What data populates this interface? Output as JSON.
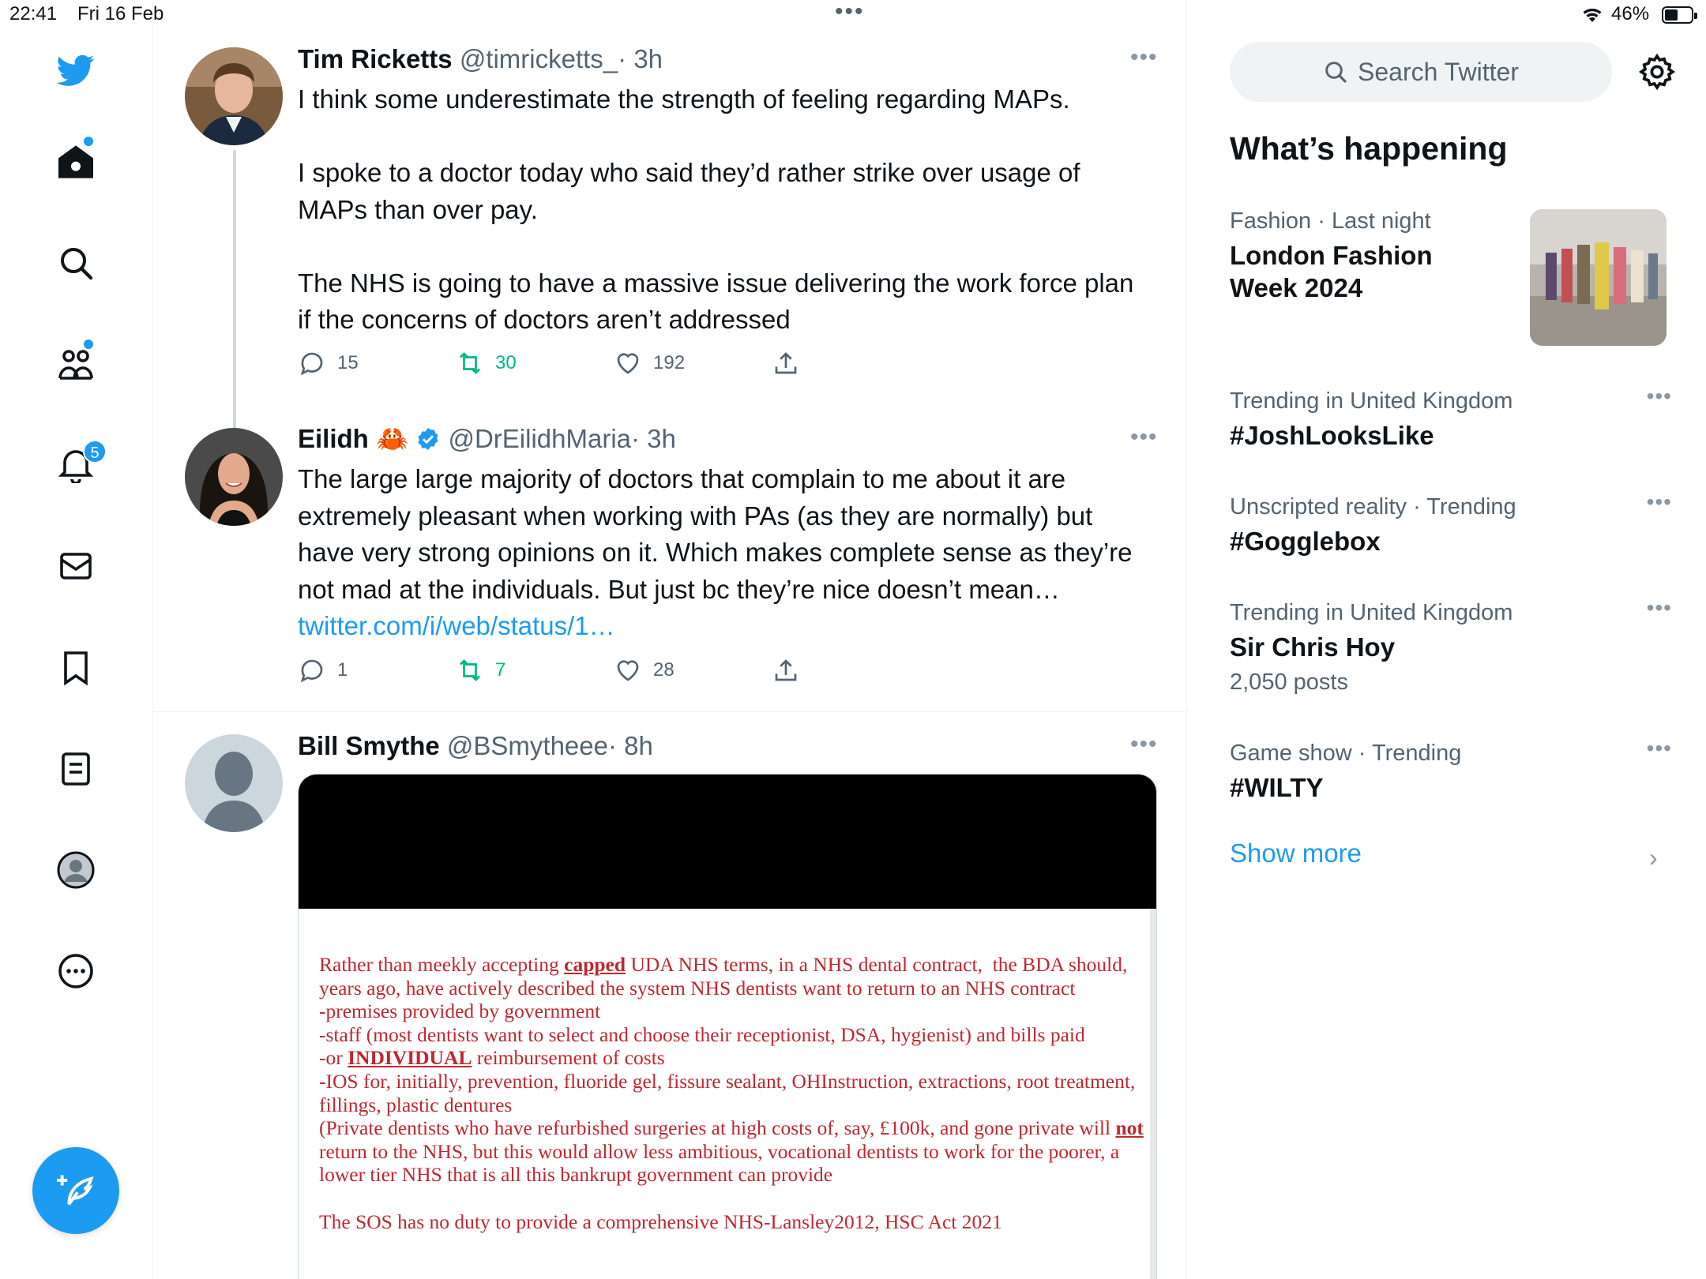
{
  "status_bar": {
    "time": "22:41",
    "date": "Fri 16 Feb",
    "battery": "46%",
    "battery_level": 0.46
  },
  "nav": {
    "items": [
      {
        "name": "twitter-logo",
        "icon": "bird-icon"
      },
      {
        "name": "home",
        "icon": "home-icon",
        "dot": true
      },
      {
        "name": "explore",
        "icon": "search-icon"
      },
      {
        "name": "communities",
        "icon": "people-icon",
        "dot": true
      },
      {
        "name": "notifications",
        "icon": "bell-icon",
        "badge": "5"
      },
      {
        "name": "messages",
        "icon": "mail-icon"
      },
      {
        "name": "bookmarks",
        "icon": "bookmark-icon"
      },
      {
        "name": "lists",
        "icon": "list-icon"
      },
      {
        "name": "profile",
        "icon": "avatar-icon"
      },
      {
        "name": "more",
        "icon": "more-circle-icon"
      }
    ],
    "notification_badge": "5",
    "compose_icon": "compose-feather-icon"
  },
  "timeline": {
    "tweets": [
      {
        "name": "Tim Ricketts",
        "handle": "@timricketts_",
        "time": "· 3h",
        "text": "I think some underestimate the strength of feeling regarding MAPs.\n\nI spoke to a doctor today who said they’d rather strike over usage of MAPs than over pay.\n\nThe NHS is going to have a massive issue delivering the work force plan if the concerns of doctors aren’t addressed",
        "replies": "15",
        "retweets": "30",
        "likes": "192"
      },
      {
        "name": "Eilidh",
        "emoji": "🦀",
        "verified": true,
        "handle": "@DrEilidhMaria",
        "time": "· 3h",
        "text": "The large large majority of doctors that complain to me about it are extremely pleasant when working with PAs (as they are normally) but have very strong opinions on it. Which makes complete sense as they’re not mad at the individuals. But just bc they’re nice doesn’t mean… ",
        "link": "twitter.com/i/web/status/1…",
        "replies": "1",
        "retweets": "7",
        "likes": "28"
      },
      {
        "name": "Bill Smythe",
        "handle": "@BSmytheee",
        "time": "· 8h",
        "media_document": {
          "line1_a": "Rather than meekly accepting ",
          "line1_u": "capped",
          "line1_b": " UDA NHS terms, in a NHS dental contract,  the BDA should, years ago, have actively described the system NHS dentists want to return to an NHS contract\n-premises provided by government\n-staff (most dentists want to select and choose their receptionist, DSA, hygienist) and bills paid\n-or ",
          "line2_u": "INDIVIDUAL",
          "line2_b": " reimbursement of costs\n-IOS for, initially, prevention, fluoride gel, fissure sealant, OHInstruction, extractions, root treatment, fillings, plastic dentures\n(Private dentists who have refurbished surgeries at high costs of, say, £100k, and gone private will ",
          "line3_u": "not",
          "line3_b": " return to the NHS, but this would allow less ambitious, vocational dentists to work for the poorer, a lower tier NHS that is all this bankrupt government can provide\n\nThe SOS has no duty to provide a comprehensive NHS-Lansley2012, HSC Act 2021"
        }
      }
    ]
  },
  "sidebar": {
    "search_placeholder": "Search Twitter",
    "whats_happening": "What’s happening",
    "trends": [
      {
        "meta_a": "Fashion",
        "meta_b": " · Last night",
        "title": "London Fashion Week 2024"
      },
      {
        "meta": "Trending in United Kingdom",
        "title": "#JoshLooksLike"
      },
      {
        "meta": "Unscripted reality · Trending",
        "title": "#Gogglebox"
      },
      {
        "meta": "Trending in United Kingdom",
        "title": "Sir Chris Hoy",
        "sub": "2,050 posts"
      },
      {
        "meta": "Game show · Trending",
        "title": "#WILTY"
      }
    ],
    "show_more": "Show more"
  },
  "colors": {
    "accent": "#1d9bf0",
    "retweet": "#00ba7c",
    "text_primary": "#0f1419",
    "text_secondary": "#536471",
    "document_red": "#c0272d"
  }
}
